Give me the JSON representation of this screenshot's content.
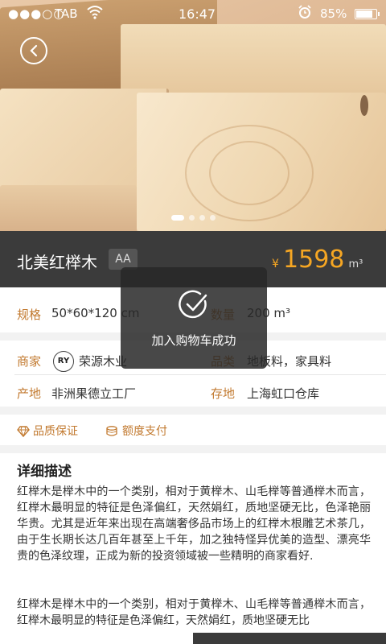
{
  "status_bar": {
    "signal": "●●●○○",
    "carrier": "TAB",
    "time": "16:47",
    "battery_percent": "85%",
    "battery_level": 0.85
  },
  "hero": {
    "image_count": 4,
    "active_index": 0
  },
  "product": {
    "name": "北美红榉木",
    "grade": "AA",
    "currency": "¥",
    "price": "1598",
    "price_unit": "m³"
  },
  "specs": {
    "spec_label": "规格",
    "spec_value": "50*60*120 cm",
    "qty_label": "数量",
    "qty_value": "200 m³",
    "merchant_label": "商家",
    "merchant_logo": "RY",
    "merchant_value": "荣源木业",
    "category_label": "品类",
    "category_value": "地板料，家具料",
    "origin_label": "产地",
    "origin_value": "非洲果德立工厂",
    "storage_label": "存地",
    "storage_value": "上海虹口仓库"
  },
  "features": {
    "quality": "品质保证",
    "payment": "额度支付"
  },
  "description": {
    "title": "详细描述",
    "para1": "红榉木是榉木中的一个类别，相对于黄榉木、山毛榉等普通榉木而言，红榉木最明显的特征是色泽偏红，天然娟红，质地坚硬无比，色泽艳丽华贵。尤其是近年来出现在高端奢侈品市场上的红榉木根雕艺术茶几，由于生长期长达几百年甚至上千年，加之独特怪异优美的造型、漂亮华贵的色泽纹理，正成为新的投资领域被一些精明的商家看好.",
    "para2": "红榉木是榉木中的一个类别，相对于黄榉木、山毛榉等普通榉木而言，红榉木最明显的特征是色泽偏红，天然娟红，质地坚硬无比"
  },
  "toast": {
    "message": "加入购物车成功"
  },
  "colors": {
    "accent": "#c27a30",
    "price": "#f5a623",
    "dark_bar": "#3b3b3b"
  }
}
